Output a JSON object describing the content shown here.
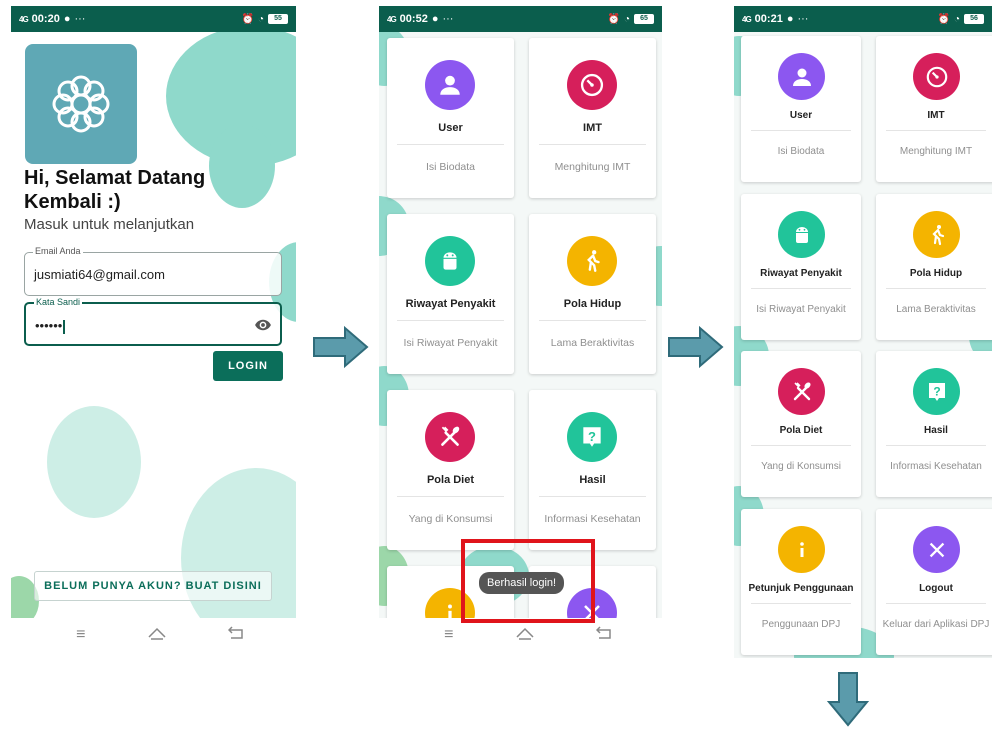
{
  "colors": {
    "brand_dark": "#0b5e4d",
    "blob": "#8fd9cb",
    "purple": "#8c57f0",
    "pink": "#d61f5b",
    "green": "#21c49a",
    "amber": "#f4b400",
    "arrow": "#5b9bab"
  },
  "screen1": {
    "status": {
      "signal": "4G",
      "time": "00:20",
      "dots": "···",
      "battery": "55"
    },
    "greeting": "Hi, Selamat Datang Kembali :)",
    "subtitle": "Masuk untuk melanjutkan",
    "email": {
      "label": "Email Anda",
      "value": "jusmiati64@gmail.com"
    },
    "password": {
      "label": "Kata Sandi",
      "value": "••••••"
    },
    "login_button": "LOGIN",
    "register_button": "BELUM PUNYA AKUN? BUAT DISINI"
  },
  "screen2": {
    "status": {
      "signal": "4G",
      "time": "00:52",
      "dots": "···",
      "battery": "65"
    },
    "menu": [
      {
        "title": "User",
        "subtitle": "Isi Biodata",
        "icon": "person-icon"
      },
      {
        "title": "IMT",
        "subtitle": "Menghitung IMT",
        "icon": "timer-icon"
      },
      {
        "title": "Riwayat Penyakit",
        "subtitle": "Isi Riwayat Penyakit",
        "icon": "android-icon"
      },
      {
        "title": "Pola Hidup",
        "subtitle": "Lama Beraktivitas",
        "icon": "walking-icon"
      },
      {
        "title": "Pola Diet",
        "subtitle": "Yang di Konsumsi",
        "icon": "cutlery-icon"
      },
      {
        "title": "Hasil",
        "subtitle": "Informasi Kesehatan",
        "icon": "question-icon"
      }
    ],
    "toast": "Berhasil login!"
  },
  "screen3": {
    "status": {
      "signal": "4G",
      "time": "00:21",
      "dots": "···",
      "battery": "56"
    },
    "menu": [
      {
        "title": "User",
        "subtitle": "Isi Biodata",
        "icon": "person-icon"
      },
      {
        "title": "IMT",
        "subtitle": "Menghitung IMT",
        "icon": "timer-icon"
      },
      {
        "title": "Riwayat Penyakit",
        "subtitle": "Isi Riwayat Penyakit",
        "icon": "android-icon"
      },
      {
        "title": "Pola Hidup",
        "subtitle": "Lama Beraktivitas",
        "icon": "walking-icon"
      },
      {
        "title": "Pola Diet",
        "subtitle": "Yang di Konsumsi",
        "icon": "cutlery-icon"
      },
      {
        "title": "Hasil",
        "subtitle": "Informasi Kesehatan",
        "icon": "question-icon"
      },
      {
        "title": "Petunjuk Penggunaan",
        "subtitle": "Penggunaan DPJ",
        "icon": "info-icon"
      },
      {
        "title": "Logout",
        "subtitle": "Keluar dari Aplikasi DPJ",
        "icon": "close-icon"
      }
    ]
  },
  "navbar_icons": [
    "menu-icon",
    "home-icon",
    "back-icon"
  ]
}
